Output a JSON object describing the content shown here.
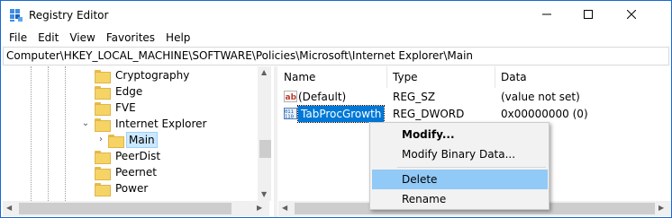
{
  "window": {
    "title": "Registry Editor",
    "icon": "registry-icon"
  },
  "menubar": [
    "File",
    "Edit",
    "View",
    "Favorites",
    "Help"
  ],
  "address": "Computer\\HKEY_LOCAL_MACHINE\\SOFTWARE\\Policies\\Microsoft\\Internet Explorer\\Main",
  "tree": {
    "items": [
      {
        "label": "Cryptography"
      },
      {
        "label": "Edge"
      },
      {
        "label": "FVE"
      },
      {
        "label": "Internet Explorer"
      },
      {
        "label": "Main"
      },
      {
        "label": "PeerDist"
      },
      {
        "label": "Peernet"
      },
      {
        "label": "Power"
      }
    ]
  },
  "list": {
    "columns": [
      "Name",
      "Type",
      "Data"
    ],
    "rows": [
      {
        "name": "(Default)",
        "type": "REG_SZ",
        "data": "(value not set)",
        "icon": "string-value-icon"
      },
      {
        "name": "TabProcGrowth",
        "type": "REG_DWORD",
        "data": "0x00000000 (0)",
        "icon": "binary-value-icon"
      }
    ]
  },
  "context_menu": {
    "items": [
      {
        "label": "Modify..."
      },
      {
        "label": "Modify Binary Data..."
      },
      {
        "label": "Delete"
      },
      {
        "label": "Rename"
      }
    ]
  },
  "colors": {
    "accent": "#0078d7",
    "hover": "#91c9f7",
    "border": "#1b6ad1"
  }
}
